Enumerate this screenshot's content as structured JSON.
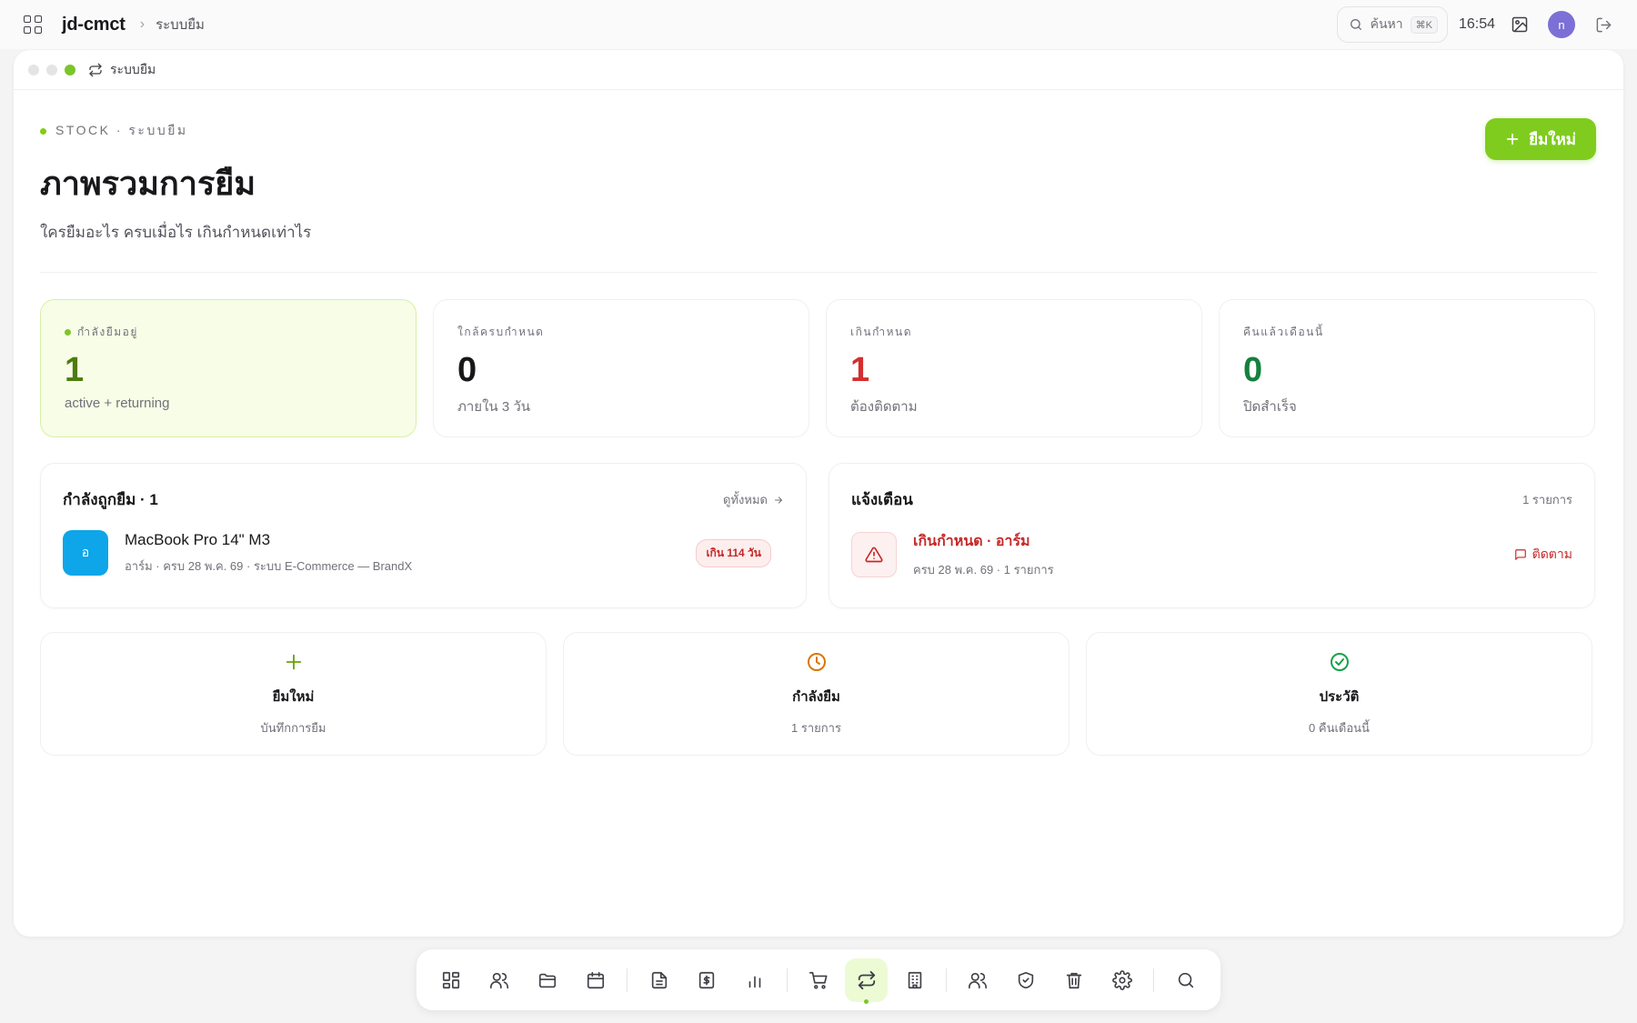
{
  "topbar": {
    "brand": "jd-cmct",
    "breadcrumb": "ระบบยืม",
    "search_label": "ค้นหา",
    "search_shortcut": "⌘K",
    "clock": "16:54",
    "avatar_initial": "n"
  },
  "window": {
    "title": "ระบบยืม"
  },
  "header": {
    "eyebrow": "STOCK · ระบบยืม",
    "title": "ภาพรวมการยืม",
    "subtitle": "ใครยืมอะไร ครบเมื่อไร เกินกำหนดเท่าไร",
    "new_button": "ยืมใหม่"
  },
  "stats": [
    {
      "label": "กำลังยืมอยู่",
      "value": "1",
      "sub": "active + returning",
      "color": "#4d7c0f"
    },
    {
      "label": "ใกล้ครบกำหนด",
      "value": "0",
      "sub": "ภายใน 3 วัน",
      "color": "#18181b"
    },
    {
      "label": "เกินกำหนด",
      "value": "1",
      "sub": "ต้องติดตาม",
      "color": "#d32f2f"
    },
    {
      "label": "คืนแล้วเดือนนี้",
      "value": "0",
      "sub": "ปิดสำเร็จ",
      "color": "#15803d"
    }
  ],
  "borrowed_panel": {
    "title": "กำลังถูกยืม · 1",
    "view_all": "ดูทั้งหมด",
    "item": {
      "initial": "อ",
      "name": "MacBook Pro 14\" M3",
      "meta": "อาร์ม · ครบ 28 พ.ค. 69 · ระบบ E-Commerce — BrandX",
      "badge": "เกิน 114 วัน"
    }
  },
  "alert_panel": {
    "title": "แจ้งเตือน",
    "count": "1 รายการ",
    "item": {
      "title": "เกินกำหนด · อาร์ม",
      "meta": "ครบ 28 พ.ค. 69 · 1 รายการ",
      "action": "ติดตาม"
    }
  },
  "quick_actions": [
    {
      "icon": "plus-icon",
      "title": "ยืมใหม่",
      "sub": "บันทึกการยืม",
      "color": "#65a30d"
    },
    {
      "icon": "clock-icon",
      "title": "กำลังยืม",
      "sub": "1 รายการ",
      "color": "#d97706"
    },
    {
      "icon": "check-circle-icon",
      "title": "ประวัติ",
      "sub": "0 คืนเดือนนี้",
      "color": "#16a34a"
    }
  ],
  "dock": {
    "active": "transfer-icon",
    "items": [
      "grid-icon",
      "users-icon",
      "folder-icon",
      "calendar-icon",
      "document-icon",
      "receipt-icon",
      "bar-chart-icon",
      "cart-icon",
      "transfer-icon",
      "building-icon",
      "team-icon",
      "shield-icon",
      "trash-icon",
      "settings-icon",
      "search-icon"
    ]
  },
  "colors": {
    "accent": "#7fcc1f",
    "danger": "#c62828",
    "info": "#0ea5e9"
  }
}
